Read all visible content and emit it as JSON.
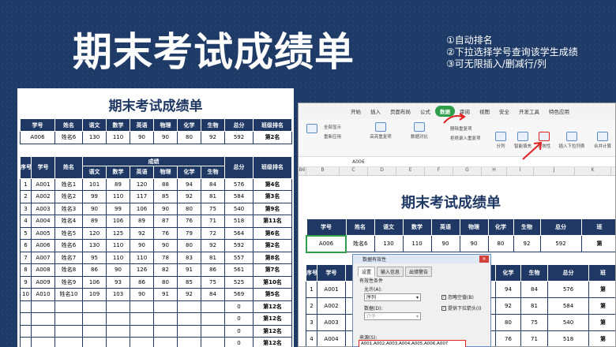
{
  "hero": {
    "title": "期末考试成绩单"
  },
  "notes": [
    "①自动排名",
    "②下拉选择学号查询该学生成绩",
    "③可无限插入/删减行/列"
  ],
  "left_sheet": {
    "title": "期末考试成绩单",
    "query_headers": [
      "学号",
      "姓名",
      "语文",
      "数学",
      "英语",
      "物理",
      "化学",
      "生物",
      "总分",
      "班级排名"
    ],
    "query_row": [
      "A006",
      "姓名6",
      "130",
      "110",
      "90",
      "90",
      "80",
      "92",
      "592",
      "第2名"
    ],
    "main_headers": {
      "seq": "序号",
      "id": "学号",
      "name": "姓名",
      "group": "成绩",
      "subjects": [
        "语文",
        "数学",
        "英语",
        "物理",
        "化学",
        "生物"
      ],
      "total": "总分",
      "rank": "班级排名"
    },
    "rows": [
      [
        "1",
        "A001",
        "姓名1",
        "101",
        "89",
        "120",
        "88",
        "94",
        "84",
        "576",
        "第4名"
      ],
      [
        "2",
        "A002",
        "姓名2",
        "99",
        "110",
        "117",
        "85",
        "92",
        "81",
        "584",
        "第3名"
      ],
      [
        "3",
        "A003",
        "姓名3",
        "90",
        "99",
        "106",
        "90",
        "80",
        "75",
        "540",
        "第9名"
      ],
      [
        "4",
        "A004",
        "姓名4",
        "89",
        "106",
        "89",
        "87",
        "76",
        "71",
        "518",
        "第11名"
      ],
      [
        "5",
        "A005",
        "姓名5",
        "120",
        "125",
        "92",
        "76",
        "79",
        "72",
        "564",
        "第6名"
      ],
      [
        "6",
        "A006",
        "姓名6",
        "130",
        "110",
        "90",
        "90",
        "80",
        "92",
        "592",
        "第2名"
      ],
      [
        "7",
        "A007",
        "姓名7",
        "95",
        "110",
        "110",
        "78",
        "83",
        "81",
        "557",
        "第8名"
      ],
      [
        "8",
        "A008",
        "姓名8",
        "86",
        "90",
        "126",
        "82",
        "91",
        "86",
        "561",
        "第7名"
      ],
      [
        "9",
        "A009",
        "姓名9",
        "106",
        "93",
        "86",
        "80",
        "85",
        "75",
        "525",
        "第10名"
      ],
      [
        "10",
        "A010",
        "姓名10",
        "109",
        "103",
        "90",
        "91",
        "92",
        "84",
        "569",
        "第5名"
      ],
      [
        "",
        "",
        "",
        "",
        "",
        "",
        "",
        "",
        "",
        "0",
        "第12名"
      ],
      [
        "",
        "",
        "",
        "",
        "",
        "",
        "",
        "",
        "",
        "0",
        "第12名"
      ],
      [
        "",
        "",
        "",
        "",
        "",
        "",
        "",
        "",
        "",
        "0",
        "第12名"
      ],
      [
        "",
        "",
        "",
        "",
        "",
        "",
        "",
        "",
        "",
        "0",
        "第12名"
      ],
      [
        "",
        "",
        "",
        "",
        "",
        "",
        "",
        "",
        "",
        "0",
        "第12名"
      ]
    ]
  },
  "spreadsheet": {
    "menu": [
      "开始",
      "插入",
      "页面布局",
      "公式",
      "数据",
      "审阅",
      "视图",
      "安全",
      "开发工具",
      "特色应用"
    ],
    "active_menu": "数据",
    "ribbon": [
      "全部显示",
      "重新应用",
      "高亮重复项",
      "数据对比",
      "删除重复项",
      "拒绝录入重复项",
      "分列",
      "智能填充",
      "有效性",
      "插入下拉列表",
      "合并计算"
    ],
    "cell_ref": "B6",
    "formula_value": "A006",
    "columns": [
      "B",
      "C",
      "D",
      "E",
      "F",
      "G",
      "H",
      "I",
      "J",
      "K"
    ],
    "title": "期末考试成绩单",
    "query_headers": [
      "学号",
      "姓名",
      "语文",
      "数学",
      "英语",
      "物理",
      "化学",
      "生物",
      "总分",
      "班"
    ],
    "query_row": [
      "A006",
      "姓名6",
      "130",
      "110",
      "90",
      "90",
      "80",
      "92",
      "592",
      "第"
    ],
    "row_numbers": [
      "4",
      "5",
      "6",
      "7",
      "8"
    ],
    "rows_right": [
      [
        "94",
        "84",
        "576",
        "第"
      ],
      [
        "92",
        "81",
        "584",
        "第"
      ],
      [
        "80",
        "75",
        "540",
        "第"
      ],
      [
        "76",
        "71",
        "518",
        "第"
      ],
      [
        "79",
        "72",
        "564",
        "第"
      ]
    ],
    "rows_left": [
      [
        "1",
        "A001"
      ],
      [
        "2",
        "A002"
      ],
      [
        "3",
        "A003"
      ],
      [
        "4",
        "A004"
      ],
      [
        "5",
        "A005"
      ]
    ]
  },
  "dialog": {
    "title": "数据有效性",
    "tabs": [
      "设置",
      "输入信息",
      "出错警告"
    ],
    "criteria_label": "有效性条件",
    "allow_label": "允许(A):",
    "allow_value": "序列",
    "data_label": "数据(D):",
    "data_value": "介于",
    "source_label": "来源(S):",
    "source_value": "A001,A002,A003,A004,A005,A006,A007",
    "ignore_blank": "忽略空值(B)",
    "dropdown": "提供下拉箭头(I)"
  }
}
